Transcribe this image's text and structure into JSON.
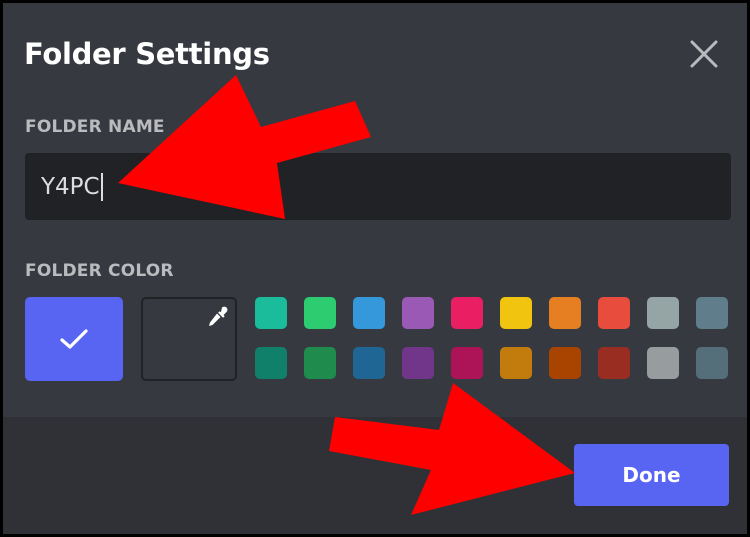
{
  "dialog": {
    "title": "Folder Settings",
    "close_icon": "close-icon"
  },
  "folder_name": {
    "label": "FOLDER NAME",
    "value": "Y4PC"
  },
  "folder_color": {
    "label": "FOLDER COLOR",
    "selected_icon": "checkmark-icon",
    "custom_icon": "eyedropper-icon",
    "default_color": "#5865f2",
    "swatches": [
      "#1abc9c",
      "#2ecc71",
      "#3498db",
      "#9b59b6",
      "#e91e63",
      "#f1c40f",
      "#e67e22",
      "#e74c3c",
      "#95a5a6",
      "#607d8b",
      "#11806a",
      "#1f8b4c",
      "#206694",
      "#71368a",
      "#ad1457",
      "#c27c0e",
      "#a84300",
      "#992d22",
      "#979c9f",
      "#546e7a"
    ]
  },
  "footer": {
    "done_label": "Done",
    "done_color": "#5865f2"
  },
  "annotations": {
    "arrow_color": "#ff0000"
  }
}
